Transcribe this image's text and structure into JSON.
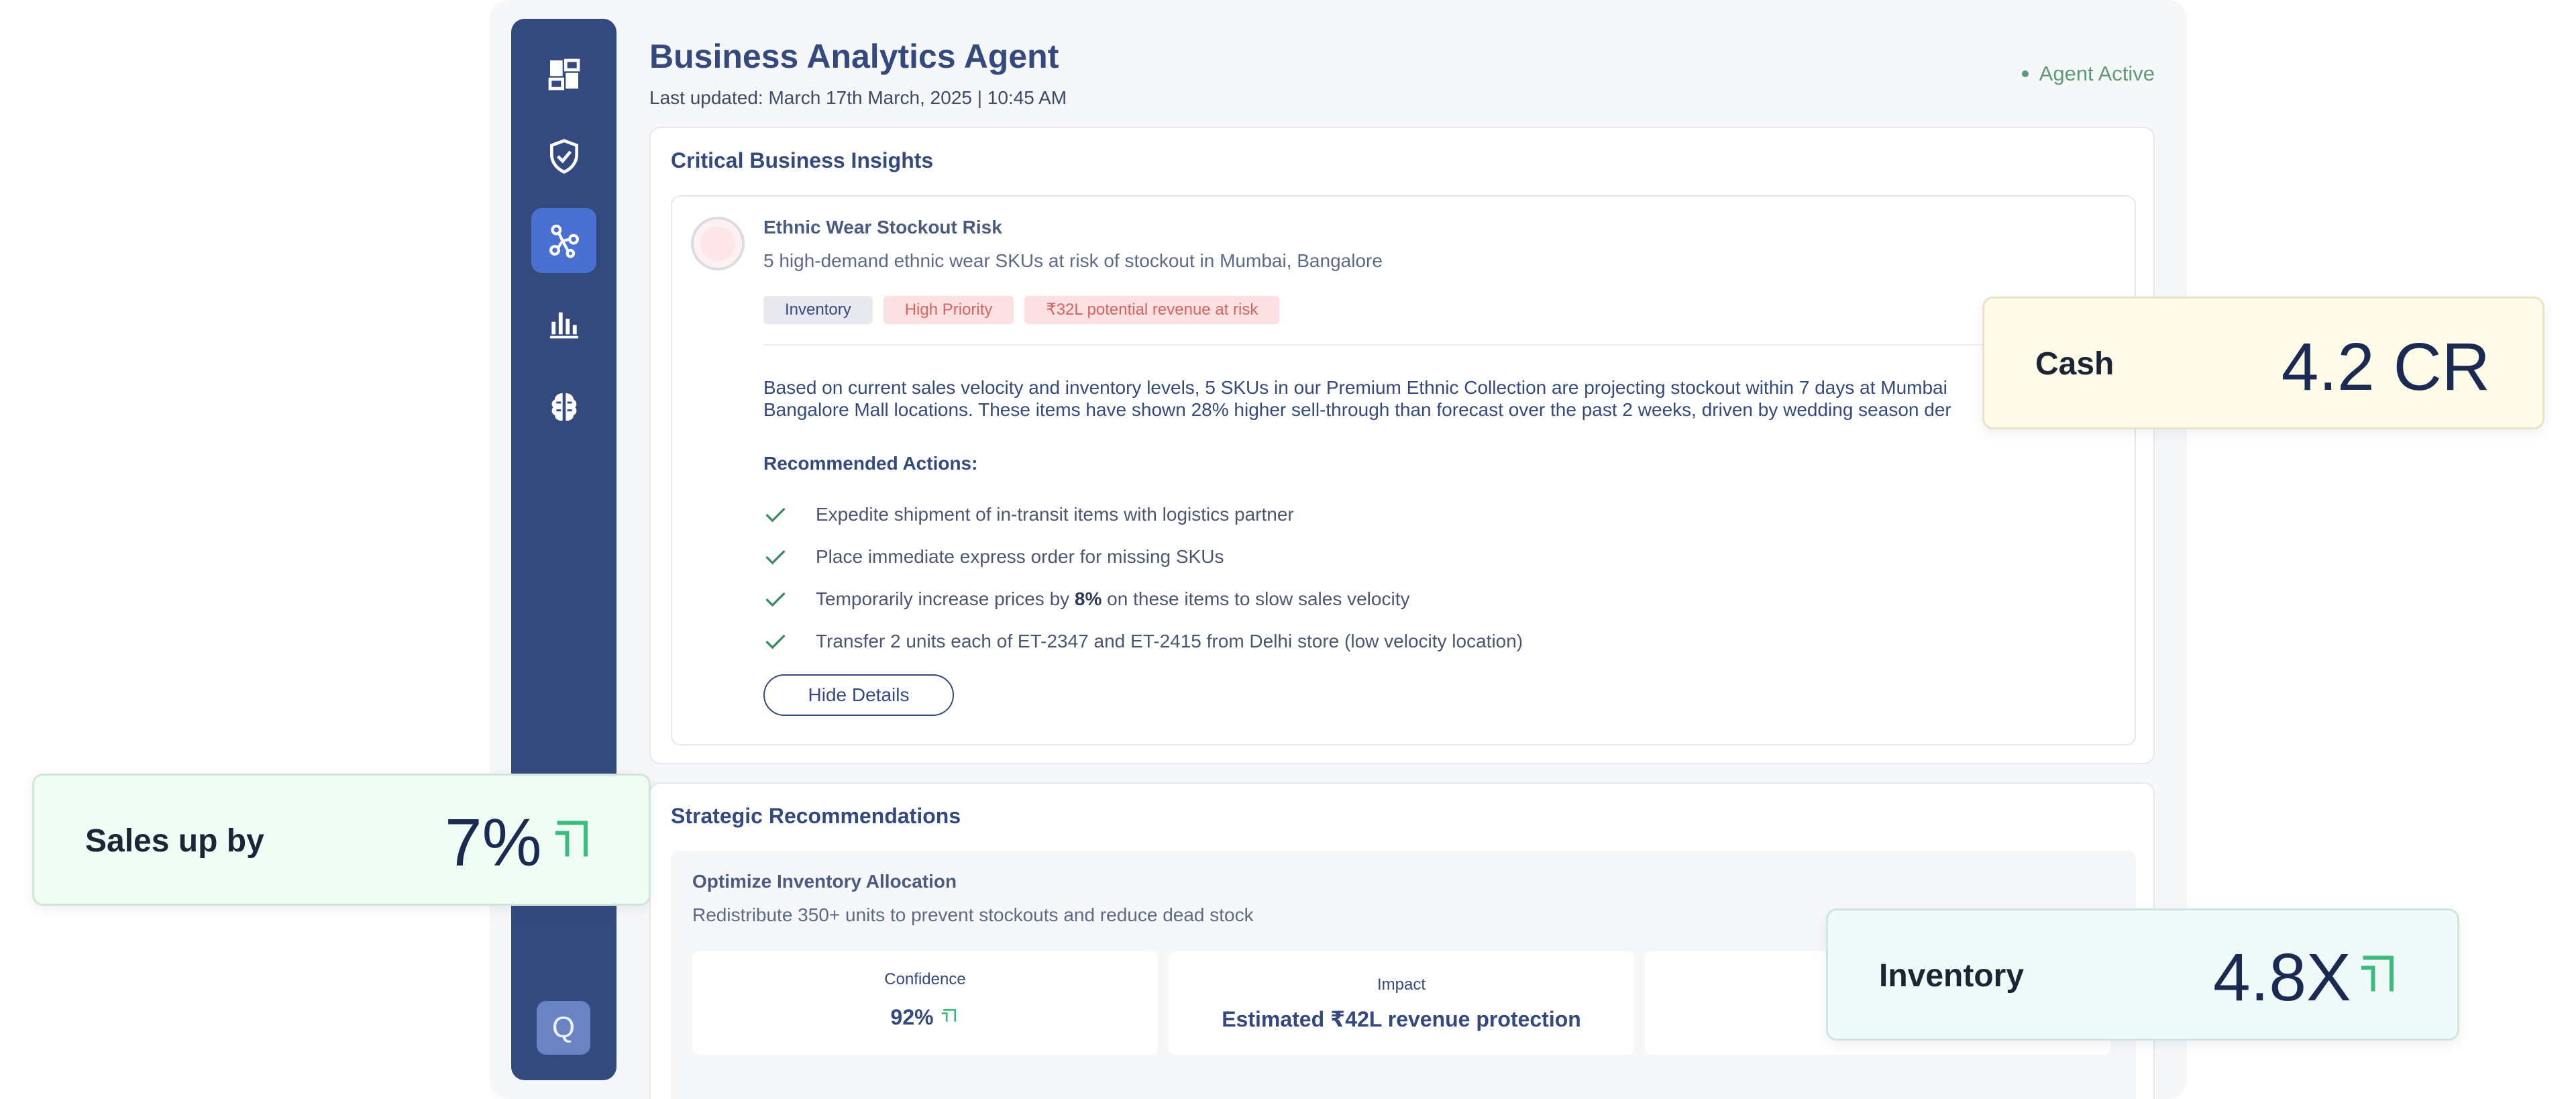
{
  "header": {
    "title": "Business Analytics Agent",
    "subtitle": "Last updated: March 17th March, 2025 | 10:45 AM",
    "status": "Agent Active"
  },
  "sidebar": {
    "items": [
      {
        "icon": "dashboard-icon"
      },
      {
        "icon": "shield-check-icon"
      },
      {
        "icon": "network-icon",
        "active": true
      },
      {
        "icon": "bar-chart-icon"
      },
      {
        "icon": "brain-icon"
      }
    ],
    "bottom_button": "Q"
  },
  "insights": {
    "title": "Critical Business Insights",
    "card": {
      "title": "Ethnic Wear Stockout Risk",
      "subtitle": "5 high-demand ethnic wear SKUs at risk of stockout in Mumbai, Bangalore",
      "tags": [
        "Inventory",
        "High Priority",
        "₹32L potential revenue at risk"
      ],
      "body_line1": "Based on current sales velocity and inventory levels, 5 SKUs in our Premium Ethnic Collection are projecting stockout within 7 days at Mumbai",
      "body_line2": "Bangalore Mall locations. These items have shown 28% higher sell-through than forecast over the past 2 weeks, driven by wedding season der",
      "recommended_heading": "Recommended Actions:",
      "actions": [
        "Expedite shipment of in-transit items with logistics partner",
        "Place immediate express order for missing SKUs",
        {
          "before": "Temporarily increase prices by ",
          "bold": "8%",
          "after": " on these items to slow sales velocity"
        },
        "Transfer 2 units each of ET-2347 and ET-2415 from Delhi store (low velocity location)"
      ],
      "hide_button": "Hide Details"
    }
  },
  "strategic": {
    "title": "Strategic Recommendations",
    "card": {
      "title": "Optimize Inventory Allocation",
      "subtitle": "Redistribute 350+ units to prevent stockouts and reduce dead stock",
      "metrics": [
        {
          "label": "Confidence",
          "value": "92%"
        },
        {
          "label": "Impact",
          "value": "Estimated ₹42L revenue protection"
        },
        {
          "label": "",
          "value": ""
        }
      ]
    }
  },
  "kpis": {
    "cash": {
      "label": "Cash",
      "value": "4.2 CR"
    },
    "sales": {
      "label": "Sales up by",
      "value": "7%"
    },
    "inventory": {
      "label": "Inventory",
      "value": "4.8X"
    }
  },
  "colors": {
    "sidebar": "#34497e",
    "accent": "#4a70d1",
    "status_green": "#5c9a78",
    "up_arrow": "#3dbb7c",
    "danger": "#d9635e"
  }
}
